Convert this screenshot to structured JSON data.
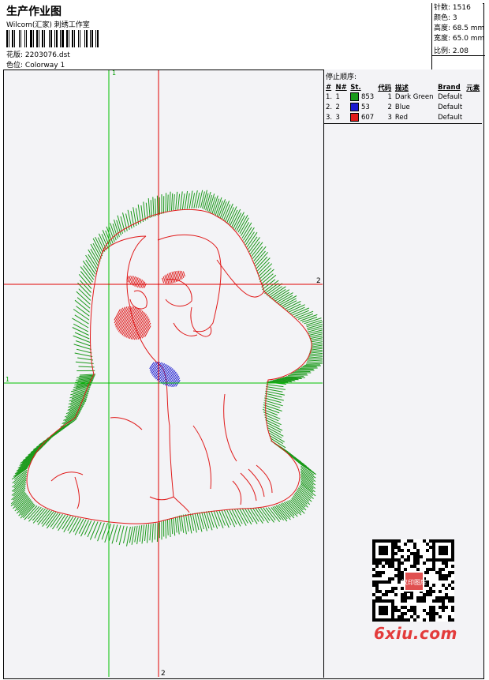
{
  "header": {
    "title": "生产作业图",
    "company": "Wilcom(汇家) 刺绣工作室",
    "design_label": "花版:",
    "design_value": "2203076.dst",
    "colorway_label": "色位:",
    "colorway_value": "Colorway 1"
  },
  "stats": {
    "stitches": "针数: 1516",
    "colors": "颜色: 3",
    "height": "高度: 68.5 mm",
    "width": "宽度: 65.0 mm",
    "scale": "比例: 2.08"
  },
  "stop_sequence": {
    "title": "停止顺序:",
    "columns": [
      "#",
      "N#",
      "St.",
      "代码",
      "描述",
      "Brand",
      "元素"
    ],
    "rows": [
      {
        "idx": "1.",
        "n": "1",
        "color": "#1a9a1a",
        "st": "853",
        "code": "1",
        "desc": "Dark Green",
        "brand": "Default"
      },
      {
        "idx": "2.",
        "n": "2",
        "color": "#1a1ad0",
        "st": "53",
        "code": "2",
        "desc": "Blue",
        "brand": "Default"
      },
      {
        "idx": "3.",
        "n": "3",
        "color": "#e01a1a",
        "st": "607",
        "code": "3",
        "desc": "Red",
        "brand": "Default"
      }
    ]
  },
  "guides": {
    "green_vertical_label": "1",
    "green_horizontal_label": "1",
    "red_vertical_label": "2",
    "red_horizontal_label": "2"
  },
  "watermark": "6xiu.com",
  "qr_label": "汉印图库",
  "colors": {
    "green_guide": "#00c000",
    "red_guide": "#e00000",
    "stitch_green": "#1a9a1a",
    "stitch_blue": "#1a1ad0",
    "stitch_red": "#e01a1a"
  }
}
